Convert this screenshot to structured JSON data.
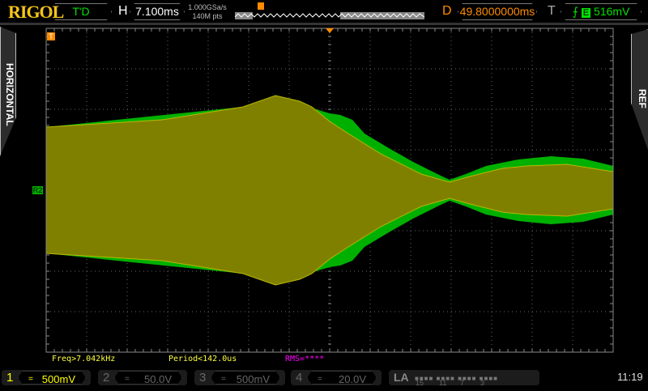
{
  "brand": "RIGOL",
  "header": {
    "run_status": "T'D",
    "h_label": "H",
    "timebase": "7.100ms",
    "sample_rate": "1.000GSa/s",
    "memory_depth": "140M pts",
    "delay_label": "D",
    "delay": "49.8000000ms",
    "trigger_label": "T",
    "trigger_source": "E",
    "trigger_level": "516mV"
  },
  "side_tabs": {
    "left": "HORIZONTAL",
    "right": "REF"
  },
  "markers": {
    "trigger": "T",
    "ref": "R2"
  },
  "measurements": {
    "freq": "Freq>7.042kHz",
    "period": "Period<142.0us",
    "rms": "RMS=****"
  },
  "channels": [
    {
      "num": "1",
      "coupling": "=",
      "scale": "500mV",
      "color": "#ffff00"
    },
    {
      "num": "2",
      "coupling": "=",
      "scale": "50.0V",
      "color": "#666666"
    },
    {
      "num": "3",
      "coupling": "=",
      "scale": "500mV",
      "color": "#666666"
    },
    {
      "num": "4",
      "coupling": "=",
      "scale": "20.0V",
      "color": "#666666"
    }
  ],
  "la": {
    "label": "LA",
    "groups": [
      "15",
      "11",
      "7",
      "3"
    ]
  },
  "clock": "11:19",
  "colors": {
    "ch1": "#ffff00",
    "ch1_fill": "#808000",
    "ref": "#00b000",
    "accent": "#ff8c00"
  }
}
